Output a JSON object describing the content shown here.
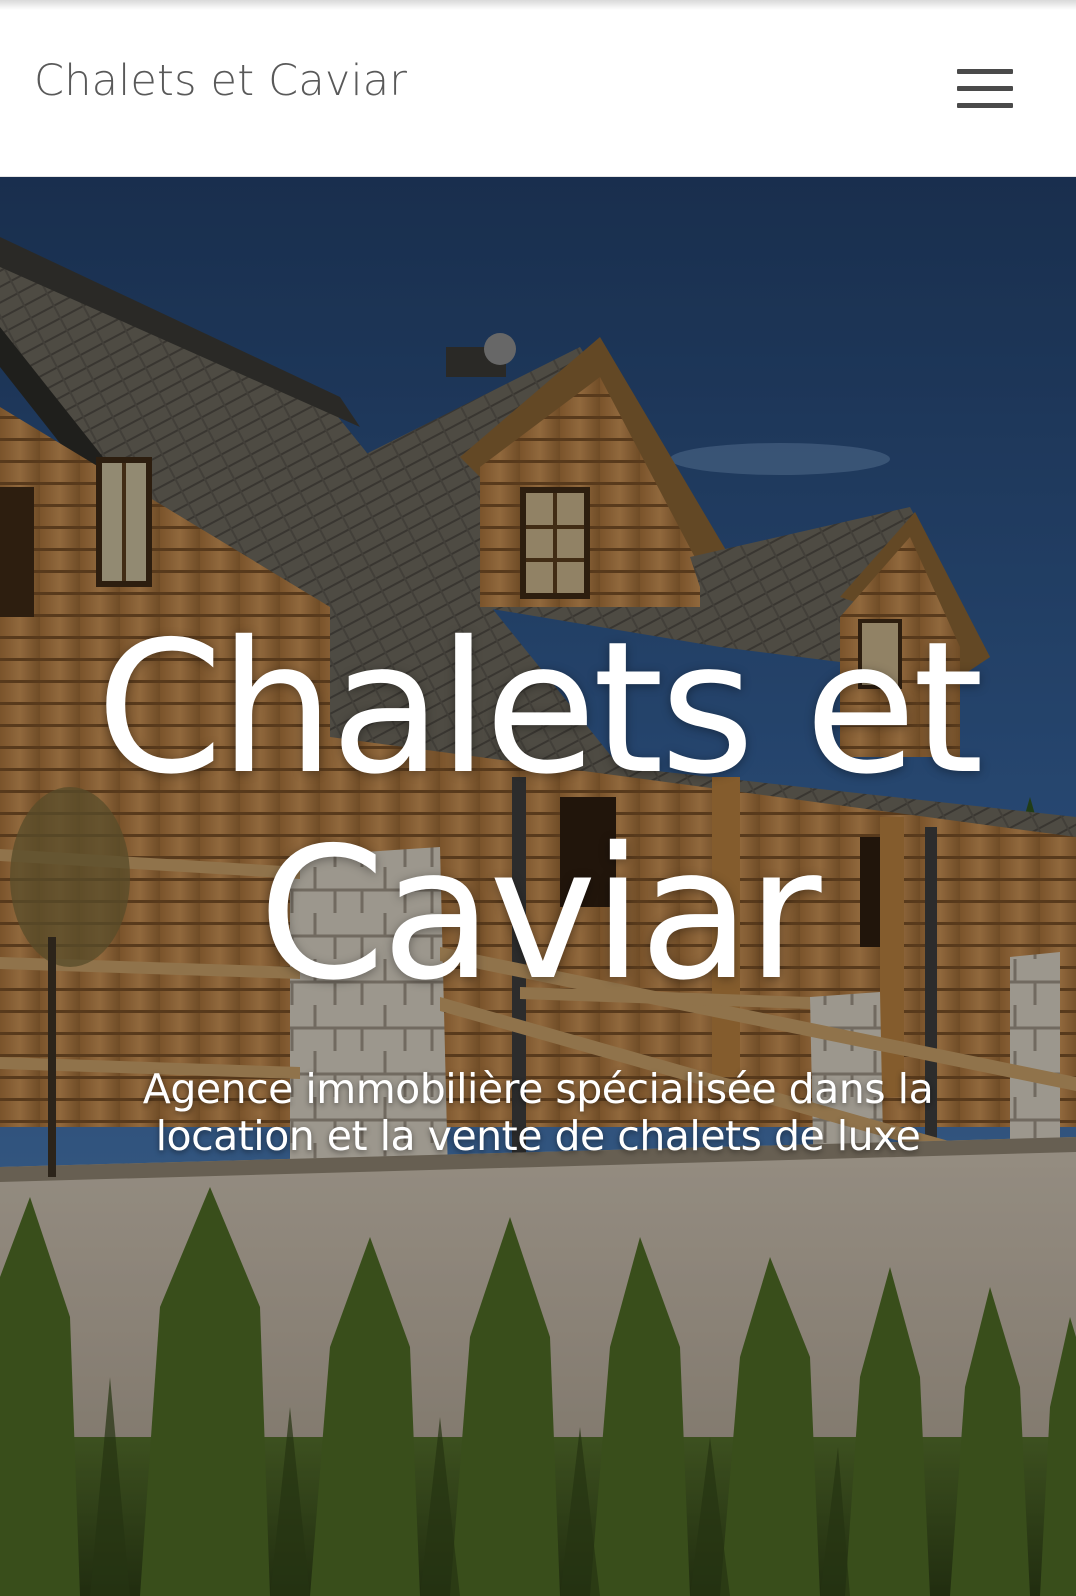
{
  "header": {
    "site_title": "Chalets et Caviar",
    "menu_icon": "hamburger-menu-icon"
  },
  "hero": {
    "title": "Chalets et Caviar",
    "subtitle": "Agence immobilière spécialisée dans la location et la vente de chalets de luxe",
    "background_image": "log-chalet-photo"
  },
  "colors": {
    "header_bg": "#ffffff",
    "header_text": "#595959",
    "hero_text": "#ffffff",
    "sky": "#1f3a63"
  }
}
